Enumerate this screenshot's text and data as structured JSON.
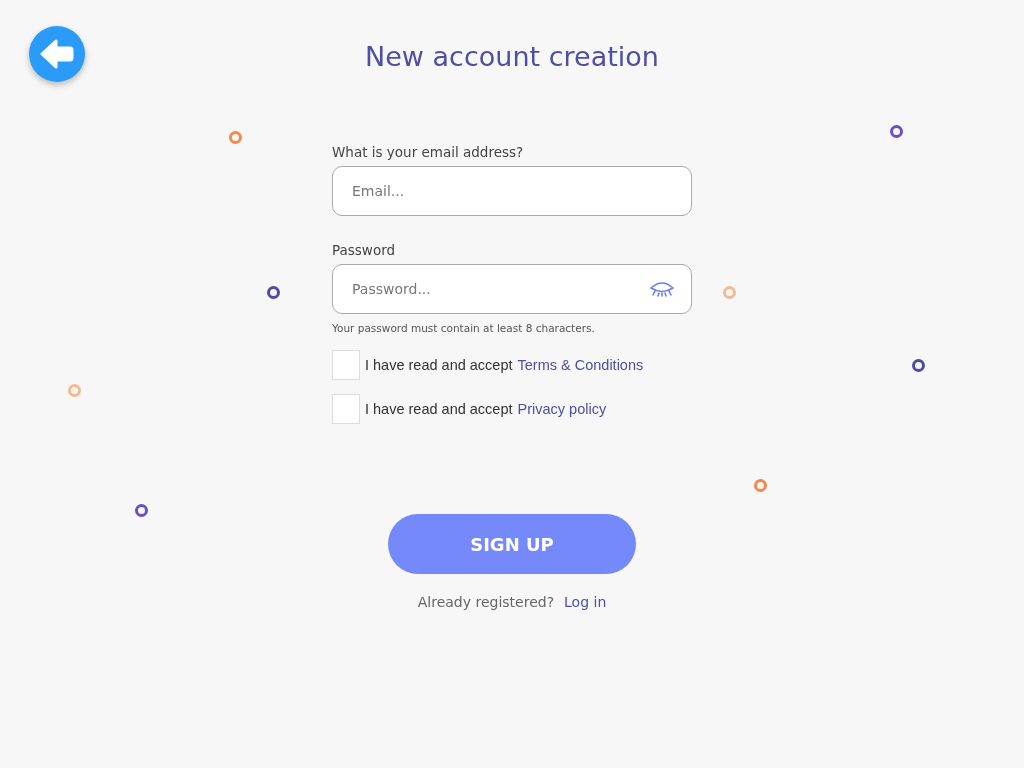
{
  "title": "New account creation",
  "email": {
    "label": "What is your email address?",
    "placeholder": "Email..."
  },
  "password": {
    "label": "Password",
    "placeholder": "Password...",
    "hint": "Your password must contain at least 8 characters."
  },
  "agreements": [
    {
      "text": "I have read and accept",
      "link": "Terms & Conditions",
      "checked": false
    },
    {
      "text": "I have read and accept",
      "link": "Privacy policy",
      "checked": false
    }
  ],
  "submit": "SIGN UP",
  "login": {
    "text": "Already registered?",
    "link": "Log in"
  }
}
